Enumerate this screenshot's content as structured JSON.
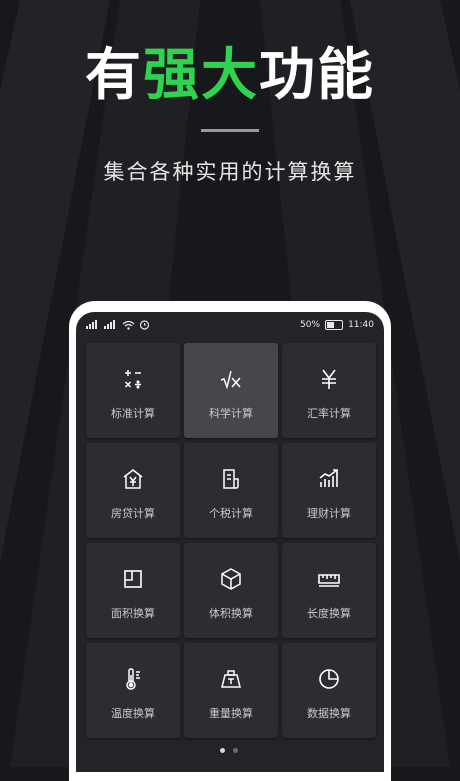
{
  "headline": {
    "part1": "有",
    "accent": "强大",
    "part2": "功能"
  },
  "subtitle": "集合各种实用的计算换算",
  "status_bar": {
    "battery": "50%",
    "time": "11:40"
  },
  "features": [
    {
      "label": "标准计算",
      "icon": "standard-calc-icon"
    },
    {
      "label": "科学计算",
      "icon": "sqrt-x-icon",
      "active": true
    },
    {
      "label": "汇率计算",
      "icon": "yen-icon"
    },
    {
      "label": "房贷计算",
      "icon": "house-yen-icon"
    },
    {
      "label": "个税计算",
      "icon": "receipt-icon"
    },
    {
      "label": "理财计算",
      "icon": "bar-trend-icon"
    },
    {
      "label": "面积换算",
      "icon": "area-square-icon"
    },
    {
      "label": "体积换算",
      "icon": "cube-icon"
    },
    {
      "label": "长度换算",
      "icon": "ruler-icon"
    },
    {
      "label": "温度换算",
      "icon": "thermometer-icon"
    },
    {
      "label": "重量换算",
      "icon": "weight-icon"
    },
    {
      "label": "数据换算",
      "icon": "pie-chart-icon"
    }
  ],
  "colors": {
    "accent": "#2fd34f",
    "background": "#17181b",
    "tile": "#2c2d31",
    "tile_active": "#45474c"
  },
  "pagination": {
    "count": 2,
    "active_index": 0
  }
}
